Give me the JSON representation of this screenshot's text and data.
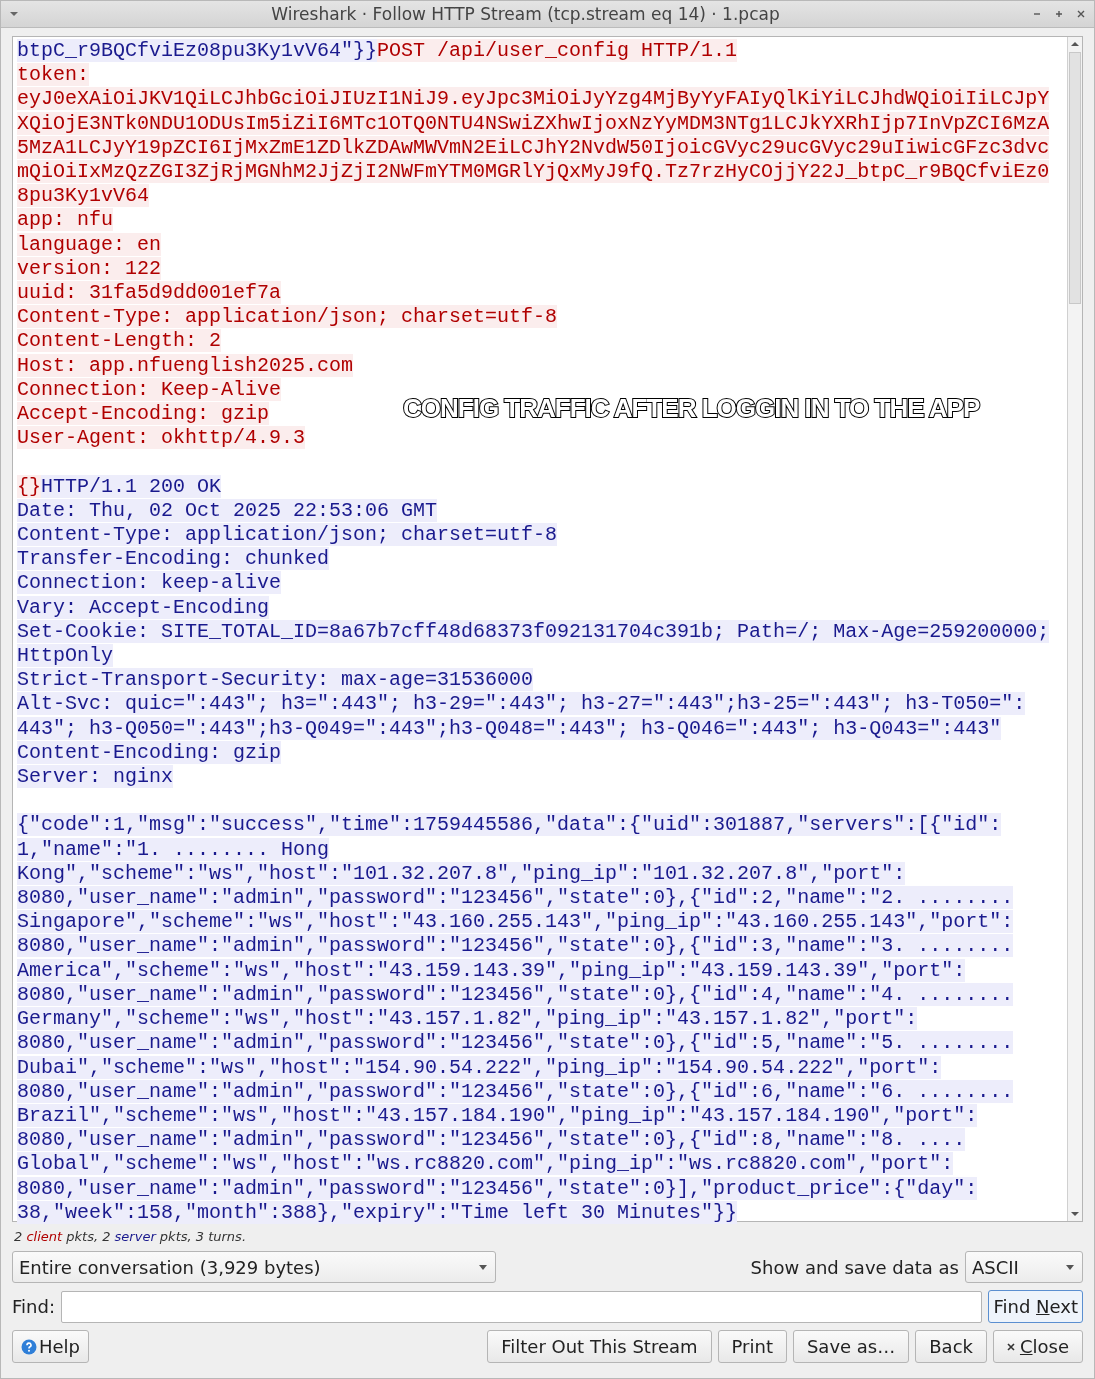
{
  "window": {
    "title": "Wireshark · Follow HTTP Stream (tcp.stream eq 14) · 1.pcap"
  },
  "stream": {
    "lines": [
      {
        "segments": [
          {
            "text": "btpC_r9BQCfviEz08pu3Ky1vV64\"}}",
            "kind": "server"
          },
          {
            "text": "POST /api/user_config HTTP/1.1",
            "kind": "client"
          }
        ]
      },
      {
        "segments": [
          {
            "text": "token:",
            "kind": "client"
          }
        ]
      },
      {
        "segments": [
          {
            "text": "eyJ0eXAiOiJKV1QiLCJhbGciOiJIUzI1NiJ9.eyJpc3MiOiJyYzg4MjByYyFAIyQlKiYiLCJhdWQiOiIiLCJpY",
            "kind": "client"
          }
        ]
      },
      {
        "segments": [
          {
            "text": "XQiOjE3NTk0NDU1ODUsIm5iZiI6MTc1OTQ0NTU4NSwiZXhwIjoxNzYyMDM3NTg1LCJkYXRhIjp7InVpZCI6MzA",
            "kind": "client"
          }
        ]
      },
      {
        "segments": [
          {
            "text": "5MzA1LCJyY19pZCI6IjMxZmE1ZDlkZDAwMWVmN2EiLCJhY2NvdW50IjoicGVyc29ucGVyc29uIiwicGFzc3dvc",
            "kind": "client"
          }
        ]
      },
      {
        "segments": [
          {
            "text": "mQiOiIxMzQzZGI3ZjRjMGNhM2JjZjI2NWFmYTM0MGRlYjQxMyJ9fQ.Tz7rzHyCOjjY22J_btpC_r9BQCfviEz0",
            "kind": "client"
          }
        ]
      },
      {
        "segments": [
          {
            "text": "8pu3Ky1vV64",
            "kind": "client"
          }
        ]
      },
      {
        "segments": [
          {
            "text": "app: nfu",
            "kind": "client"
          }
        ]
      },
      {
        "segments": [
          {
            "text": "language: en",
            "kind": "client"
          }
        ]
      },
      {
        "segments": [
          {
            "text": "version: 122",
            "kind": "client"
          }
        ]
      },
      {
        "segments": [
          {
            "text": "uuid: 31fa5d9dd001ef7a",
            "kind": "client"
          }
        ]
      },
      {
        "segments": [
          {
            "text": "Content-Type: application/json; charset=utf-8",
            "kind": "client"
          }
        ]
      },
      {
        "segments": [
          {
            "text": "Content-Length: 2",
            "kind": "client"
          }
        ]
      },
      {
        "segments": [
          {
            "text": "Host: app.nfuenglish2025.com",
            "kind": "client"
          }
        ]
      },
      {
        "segments": [
          {
            "text": "Connection: Keep-Alive",
            "kind": "client"
          }
        ]
      },
      {
        "segments": [
          {
            "text": "Accept-Encoding: gzip",
            "kind": "client"
          }
        ]
      },
      {
        "segments": [
          {
            "text": "User-Agent: okhttp/4.9.3",
            "kind": "client"
          }
        ]
      },
      {
        "kind": "blank"
      },
      {
        "segments": [
          {
            "text": "{}",
            "kind": "client"
          },
          {
            "text": "HTTP/1.1 200 OK",
            "kind": "server"
          }
        ]
      },
      {
        "segments": [
          {
            "text": "Date: Thu, 02 Oct 2025 22:53:06 GMT",
            "kind": "server"
          }
        ]
      },
      {
        "segments": [
          {
            "text": "Content-Type: application/json; charset=utf-8",
            "kind": "server"
          }
        ]
      },
      {
        "segments": [
          {
            "text": "Transfer-Encoding: chunked",
            "kind": "server"
          }
        ]
      },
      {
        "segments": [
          {
            "text": "Connection: keep-alive",
            "kind": "server"
          }
        ]
      },
      {
        "segments": [
          {
            "text": "Vary: Accept-Encoding",
            "kind": "server"
          }
        ]
      },
      {
        "segments": [
          {
            "text": "Set-Cookie: SITE_TOTAL_ID=8a67b7cff48d68373f092131704c391b; Path=/; Max-Age=259200000;",
            "kind": "server"
          }
        ]
      },
      {
        "segments": [
          {
            "text": "HttpOnly",
            "kind": "server"
          }
        ]
      },
      {
        "segments": [
          {
            "text": "Strict-Transport-Security: max-age=31536000",
            "kind": "server"
          }
        ]
      },
      {
        "segments": [
          {
            "text": "Alt-Svc: quic=\":443\"; h3=\":443\"; h3-29=\":443\"; h3-27=\":443\";h3-25=\":443\"; h3-T050=\":",
            "kind": "server"
          }
        ]
      },
      {
        "segments": [
          {
            "text": "443\"; h3-Q050=\":443\";h3-Q049=\":443\";h3-Q048=\":443\"; h3-Q046=\":443\"; h3-Q043=\":443\"",
            "kind": "server"
          }
        ]
      },
      {
        "segments": [
          {
            "text": "Content-Encoding: gzip",
            "kind": "server"
          }
        ]
      },
      {
        "segments": [
          {
            "text": "Server: nginx",
            "kind": "server"
          }
        ]
      },
      {
        "kind": "blank"
      },
      {
        "segments": [
          {
            "text": "{\"code\":1,\"msg\":\"success\",\"time\":1759445586,\"data\":{\"uid\":301887,\"servers\":[{\"id\":",
            "kind": "server"
          }
        ]
      },
      {
        "segments": [
          {
            "text": "1,\"name\":\"1. ........ Hong",
            "kind": "server"
          }
        ]
      },
      {
        "segments": [
          {
            "text": "Kong\",\"scheme\":\"ws\",\"host\":\"101.32.207.8\",\"ping_ip\":\"101.32.207.8\",\"port\":",
            "kind": "server"
          }
        ]
      },
      {
        "segments": [
          {
            "text": "8080,\"user_name\":\"admin\",\"password\":\"123456\",\"state\":0},{\"id\":2,\"name\":\"2. ........",
            "kind": "server"
          }
        ]
      },
      {
        "segments": [
          {
            "text": "Singapore\",\"scheme\":\"ws\",\"host\":\"43.160.255.143\",\"ping_ip\":\"43.160.255.143\",\"port\":",
            "kind": "server"
          }
        ]
      },
      {
        "segments": [
          {
            "text": "8080,\"user_name\":\"admin\",\"password\":\"123456\",\"state\":0},{\"id\":3,\"name\":\"3. ........",
            "kind": "server"
          }
        ]
      },
      {
        "segments": [
          {
            "text": "America\",\"scheme\":\"ws\",\"host\":\"43.159.143.39\",\"ping_ip\":\"43.159.143.39\",\"port\":",
            "kind": "server"
          }
        ]
      },
      {
        "segments": [
          {
            "text": "8080,\"user_name\":\"admin\",\"password\":\"123456\",\"state\":0},{\"id\":4,\"name\":\"4. ........",
            "kind": "server"
          }
        ]
      },
      {
        "segments": [
          {
            "text": "Germany\",\"scheme\":\"ws\",\"host\":\"43.157.1.82\",\"ping_ip\":\"43.157.1.82\",\"port\":",
            "kind": "server"
          }
        ]
      },
      {
        "segments": [
          {
            "text": "8080,\"user_name\":\"admin\",\"password\":\"123456\",\"state\":0},{\"id\":5,\"name\":\"5. ........",
            "kind": "server"
          }
        ]
      },
      {
        "segments": [
          {
            "text": "Dubai\",\"scheme\":\"ws\",\"host\":\"154.90.54.222\",\"ping_ip\":\"154.90.54.222\",\"port\":",
            "kind": "server"
          }
        ]
      },
      {
        "segments": [
          {
            "text": "8080,\"user_name\":\"admin\",\"password\":\"123456\",\"state\":0},{\"id\":6,\"name\":\"6. ........",
            "kind": "server"
          }
        ]
      },
      {
        "segments": [
          {
            "text": "Brazil\",\"scheme\":\"ws\",\"host\":\"43.157.184.190\",\"ping_ip\":\"43.157.184.190\",\"port\":",
            "kind": "server"
          }
        ]
      },
      {
        "segments": [
          {
            "text": "8080,\"user_name\":\"admin\",\"password\":\"123456\",\"state\":0},{\"id\":8,\"name\":\"8. ....",
            "kind": "server"
          }
        ]
      },
      {
        "segments": [
          {
            "text": "Global\",\"scheme\":\"ws\",\"host\":\"ws.rc8820.com\",\"ping_ip\":\"ws.rc8820.com\",\"port\":",
            "kind": "server"
          }
        ]
      },
      {
        "segments": [
          {
            "text": "8080,\"user_name\":\"admin\",\"password\":\"123456\",\"state\":0}],\"product_price\":{\"day\":",
            "kind": "server"
          }
        ]
      },
      {
        "segments": [
          {
            "text": "38,\"week\":158,\"month\":388},\"expiry\":\"Time left 30 Minutes\"}}",
            "kind": "server"
          }
        ]
      }
    ],
    "caption": "CONFIG TRAFFIC AFTER LOGGIN IN TO THE APP"
  },
  "summary": [
    {
      "text": "2 "
    },
    {
      "text": "client",
      "kind": "client"
    },
    {
      "text": " pkts, 2 "
    },
    {
      "text": "server",
      "kind": "server"
    },
    {
      "text": " pkts, 3 turns."
    }
  ],
  "conversation_select": {
    "value": "Entire conversation (3,929 bytes)"
  },
  "format": {
    "label": "Show and save data as",
    "value": "ASCII"
  },
  "find": {
    "label": "Find:",
    "button": [
      {
        "text": "Find "
      },
      {
        "text": "N",
        "underlined": true
      },
      {
        "text": "ext"
      }
    ],
    "focused": true
  },
  "buttons": [
    {
      "label": "Help",
      "kind": "help"
    },
    {
      "label": "Filter Out This Stream",
      "kind": "plain"
    },
    {
      "label": "Print",
      "kind": "plain"
    },
    {
      "label": "Save as…",
      "kind": "plain"
    },
    {
      "label": "Back",
      "kind": "plain"
    },
    {
      "label": [
        {
          "text": "C",
          "underlined": true
        },
        {
          "text": "lose"
        }
      ],
      "kind": "close"
    }
  ]
}
